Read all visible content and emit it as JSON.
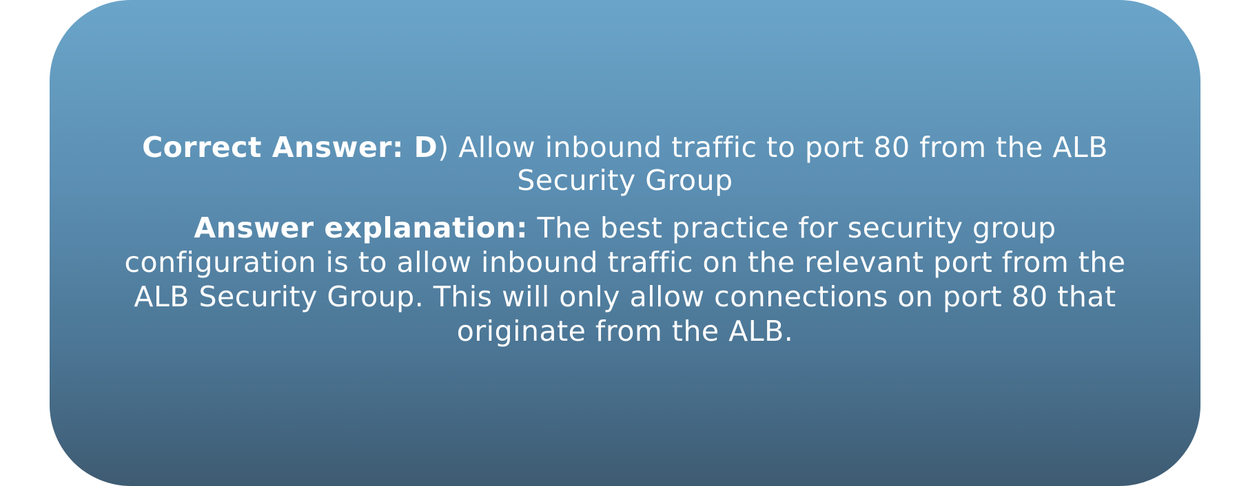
{
  "card": {
    "answer_label": "Correct Answer: D",
    "answer_text": ") Allow inbound traffic to port 80 from the ALB Security Group",
    "explanation_label": "Answer explanation:",
    "explanation_text": " The best practice for security group configuration is to allow inbound traffic on the relevant port from the ALB Security Group. This will only allow connections on port 80 that originate from the ALB."
  },
  "colors": {
    "gradient_top": "#6aa5c9",
    "gradient_bottom": "#3e5b72",
    "text": "#ffffff"
  }
}
